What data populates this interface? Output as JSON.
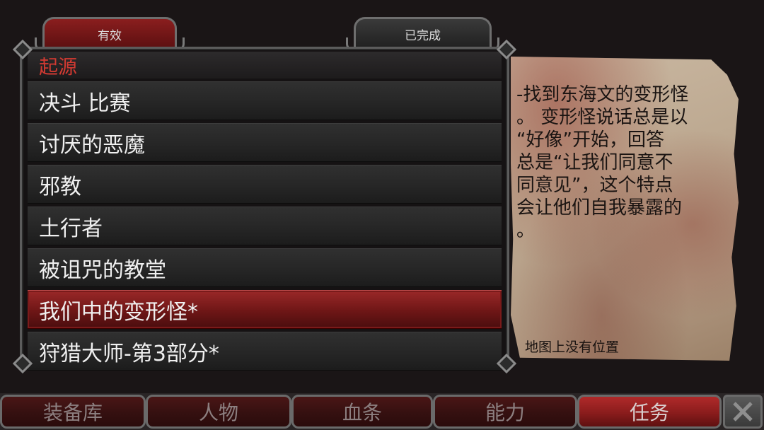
{
  "tabs": {
    "active_label": "有效",
    "completed_label": "已完成"
  },
  "quest_list": {
    "category": "起源",
    "items": [
      {
        "label": "决斗 比赛"
      },
      {
        "label": "讨厌的恶魔"
      },
      {
        "label": "邪教"
      },
      {
        "label": "土行者"
      },
      {
        "label": "被诅咒的教堂"
      },
      {
        "label": "我们中的变形怪*",
        "selected": true
      },
      {
        "label": "狩猎大师-第3部分*"
      }
    ]
  },
  "quest_detail": {
    "lines": [
      "-找到东海文的变形怪",
      "。 变形怪说话总是以",
      "“好像”开始，回答",
      "总是“让我们同意不",
      "同意见”，这个特点",
      "会让他们自我暴露的",
      "。"
    ],
    "map_status": "地图上没有位置"
  },
  "bottom_nav": {
    "items": [
      {
        "label": "装备库",
        "active": false
      },
      {
        "label": "人物",
        "active": false
      },
      {
        "label": "血条",
        "active": false
      },
      {
        "label": "能力",
        "active": false
      },
      {
        "label": "任务",
        "active": true
      }
    ],
    "close_icon": "close-x-icon"
  },
  "colors": {
    "accent_red": "#8a1c1c",
    "category_red": "#d23a32",
    "parchment": "#bda991"
  }
}
